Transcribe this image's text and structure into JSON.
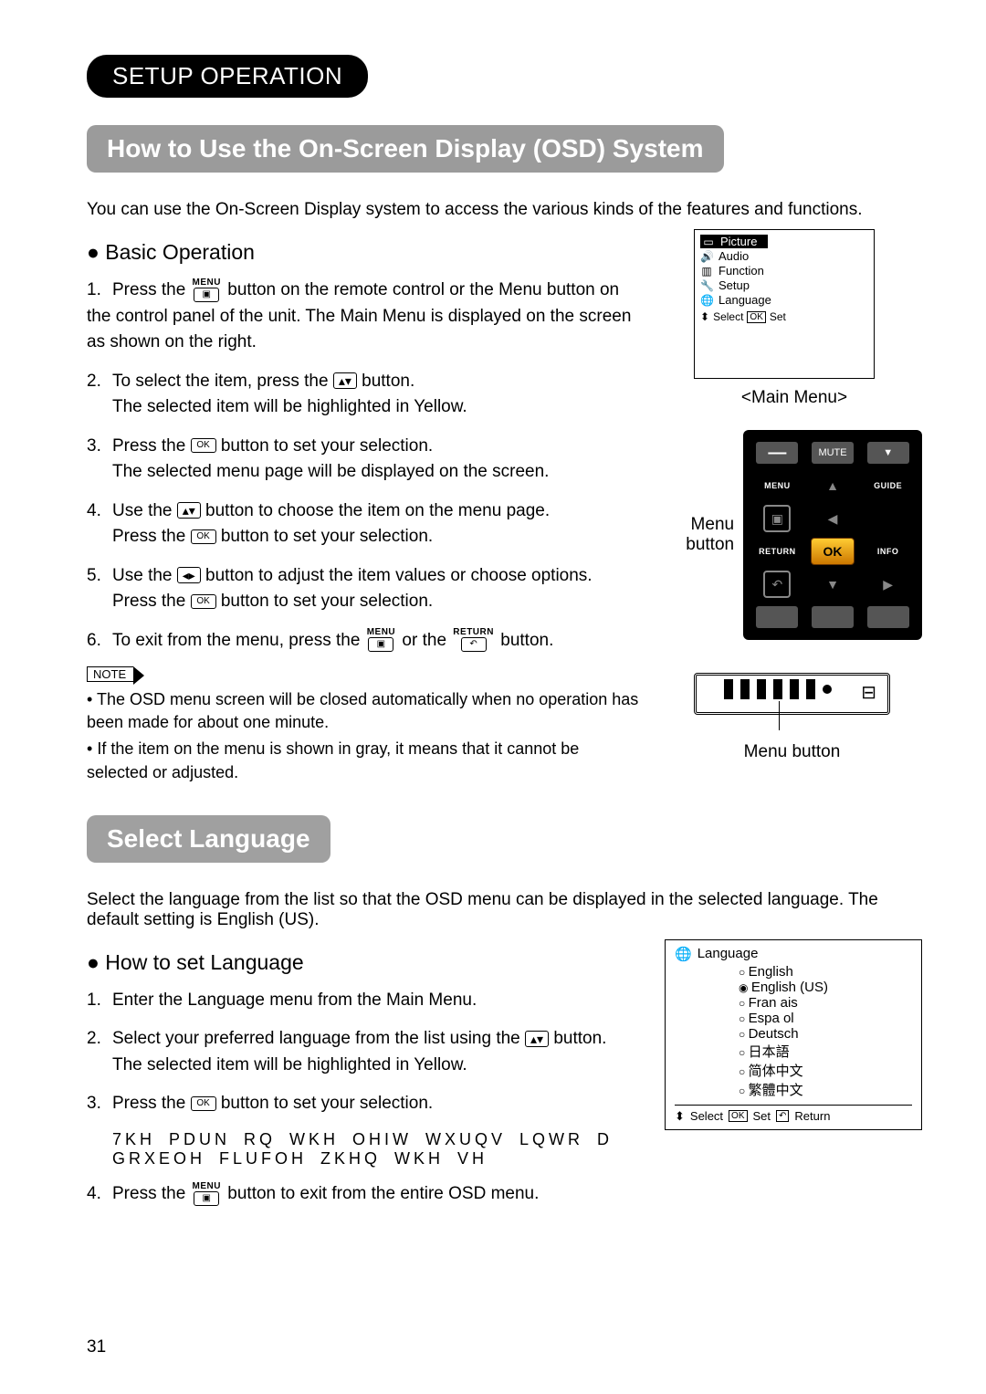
{
  "section": "SETUP OPERATION",
  "h1": "How to Use the On-Screen Display (OSD) System",
  "intro": "You can use the On-Screen Display system to access the various kinds of the features and functions.",
  "basic_heading": "Basic Operation",
  "steps": {
    "s1a": "Press the",
    "s1b": "button on the remote control or the Menu button on the control panel of the unit. The Main Menu  is displayed on the screen as shown on the right.",
    "s2a": "To select the item, press the",
    "s2b": "button.",
    "s2c": "The selected item will be highlighted in Yellow.",
    "s3a": "Press the",
    "s3b": "button to set your selection.",
    "s3c": "The selected menu page will be displayed on the screen.",
    "s4a": "Use the",
    "s4b": "button to choose the item on the menu page.",
    "s4c": "Press the",
    "s4d": "button to set your selection.",
    "s5a": "Use the",
    "s5b": "button to adjust the item values or choose options.",
    "s5c": "Press the",
    "s5d": "button to set your selection.",
    "s6a": "To exit from the menu, press the",
    "s6b": "or the",
    "s6c": "button."
  },
  "btn_labels": {
    "menu": "MENU",
    "return": "RETURN",
    "ok": "OK"
  },
  "note_label": "NOTE",
  "notes": [
    "The OSD menu screen will be closed automatically when no operation has been made for about one minute.",
    "If the item on the menu is shown in gray, it means that it cannot be selected or adjusted."
  ],
  "main_menu": {
    "items": [
      "Picture",
      "Audio",
      "Function",
      "Setup",
      "Language"
    ],
    "foot_select": "Select",
    "foot_set": "Set",
    "caption": "<Main Menu>"
  },
  "remote": {
    "mute": "MUTE",
    "menu": "MENU",
    "guide": "GUIDE",
    "return": "RETURN",
    "ok": "OK",
    "info": "INFO",
    "pointer": "Menu button"
  },
  "tv_caption": "Menu button",
  "h2": "Select Language",
  "lang_intro": "Select the language from the list so that the OSD menu can be displayed in the selected language. The default setting is English (US).",
  "lang_heading": "How to set Language",
  "lang_steps": {
    "l1": "Enter the  Language     menu from the Main Menu.",
    "l2a": "Select your preferred language from the list using the",
    "l2b": "button.",
    "l2c": "The selected item will be highlighted in Yellow.",
    "l3a": "Press the",
    "l3b": "button to set your selection.",
    "l3g": "7KH  PDUN  RQ  WKH  OHIW  WXUQV  LQWR  D  GRXEOH  FLUFOH  ZKHQ  WKH  VH",
    "l4a": "Press the",
    "l4b": "button to exit from the entire OSD menu."
  },
  "lang_box": {
    "title": "Language",
    "options": [
      "English",
      "English (US)",
      "Fran  ais",
      "Espa   ol",
      "Deutsch",
      "日本語",
      "简体中文",
      "繁體中文"
    ],
    "selected_index": 1,
    "foot_select": "Select",
    "foot_set": "Set",
    "foot_return": "Return"
  },
  "page": "31"
}
